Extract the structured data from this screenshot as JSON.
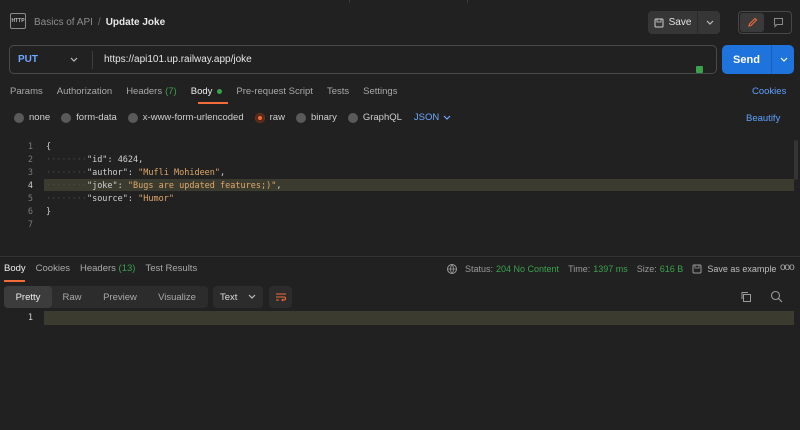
{
  "header": {
    "icon_label": "HTTP",
    "collection": "Basics of API",
    "separator": "/",
    "request_name": "Update Joke",
    "save_label": "Save"
  },
  "request": {
    "method": "PUT",
    "url": "https://api101.up.railway.app/joke",
    "send_label": "Send"
  },
  "tabs": [
    {
      "label": "Params"
    },
    {
      "label": "Authorization"
    },
    {
      "label": "Headers",
      "count": "(7)"
    },
    {
      "label": "Body"
    },
    {
      "label": "Pre-request Script"
    },
    {
      "label": "Tests"
    },
    {
      "label": "Settings"
    }
  ],
  "cookies_label": "Cookies",
  "body_types": [
    "none",
    "form-data",
    "x-www-form-urlencoded",
    "raw",
    "binary",
    "GraphQL"
  ],
  "selected_body_type": "raw",
  "format": "JSON",
  "beautify_label": "Beautify",
  "editor": {
    "line_numbers": [
      "1",
      "2",
      "3",
      "4",
      "5",
      "6",
      "7"
    ],
    "open_brace": "{",
    "close_brace": "}",
    "fields": [
      {
        "key": "\"id\"",
        "value": "4624",
        "comma": ","
      },
      {
        "key": "\"author\"",
        "value": "\"Mufli Mohideen\"",
        "comma": ","
      },
      {
        "key": "\"joke\"",
        "value": "\"Bugs are updated features;)\"",
        "comma": ","
      },
      {
        "key": "\"source\"",
        "value": "\"Humor\"",
        "comma": ""
      }
    ]
  },
  "response": {
    "tabs": [
      {
        "label": "Body"
      },
      {
        "label": "Cookies"
      },
      {
        "label": "Headers",
        "count": "(13)"
      },
      {
        "label": "Test Results"
      }
    ],
    "status_label": "Status:",
    "status_value": "204 No Content",
    "time_label": "Time:",
    "time_value": "1397 ms",
    "size_label": "Size:",
    "size_value": "616 B",
    "save_example": "Save as example",
    "more": "ooo",
    "views": [
      "Pretty",
      "Raw",
      "Preview",
      "Visualize"
    ],
    "text_format": "Text",
    "line_number": "1"
  },
  "colors": {
    "accent": "#f26b3a",
    "send": "#1f73dc",
    "link": "#5ea0ff",
    "success": "#3aa14d",
    "string": "#e0a86a"
  }
}
